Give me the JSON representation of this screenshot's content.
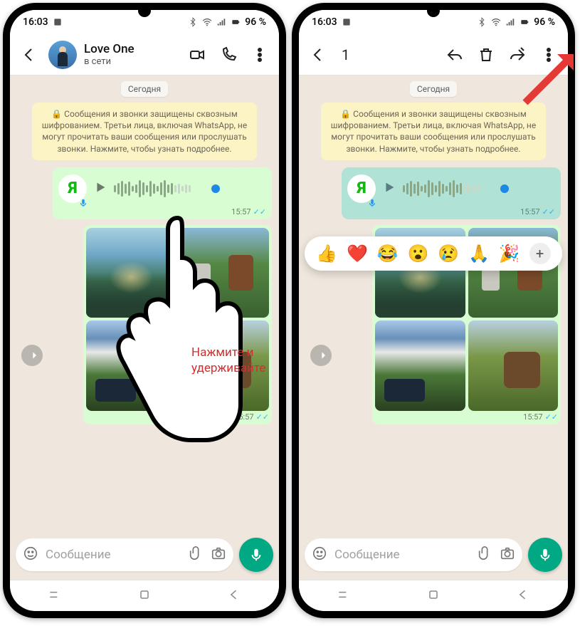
{
  "status": {
    "time": "16:03",
    "battery_text": "96 %"
  },
  "left": {
    "header": {
      "name": "Love One",
      "status": "в сети"
    },
    "date_pill": "Сегодня",
    "encryption": "🔒 Сообщения и звонки защищены сквозным шифрованием. Третьи лица, включая WhatsApp, не могут прочитать ваши сообщения или прослушать звонки. Нажмите, чтобы узнать подробнее.",
    "voice": {
      "avatar_letter": "Я",
      "time": "15:57"
    },
    "images_time": "15:57",
    "input_placeholder": "Сообщение"
  },
  "right": {
    "selection_count": "1",
    "date_pill": "Сегодня",
    "encryption": "🔒 Сообщения и звонки защищены сквозным шифрованием. Третьи лица, включая WhatsApp, не могут прочитать ваши сообщения или прослушать звонки. Нажмите, чтобы узнать подробнее.",
    "reactions": [
      "👍",
      "❤️",
      "😂",
      "😮",
      "😢",
      "🙏",
      "🎉"
    ],
    "voice": {
      "avatar_letter": "Я",
      "time": "15:57"
    },
    "images_time": "15:57",
    "input_placeholder": "Сообщение"
  },
  "annotation": {
    "line1": "Нажмите и",
    "line2": "удерживайте"
  }
}
